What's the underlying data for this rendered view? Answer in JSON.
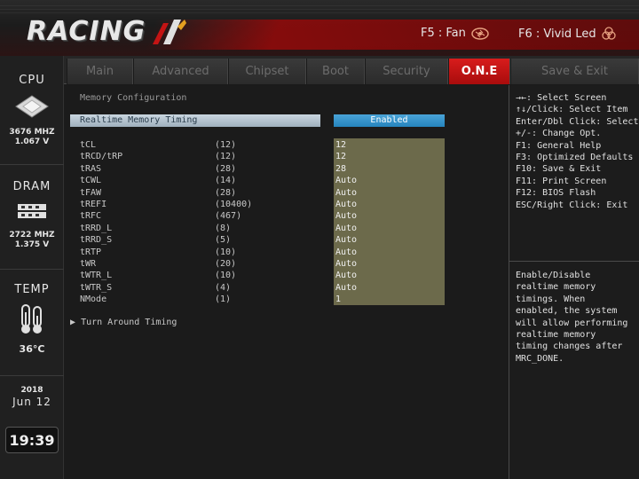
{
  "header": {
    "logo_text": "RACING",
    "fan_label": "F5 : Fan",
    "led_label": "F6 : Vivid Led"
  },
  "sidebar": {
    "cpu_title": "CPU",
    "cpu_freq": "3676 MHZ",
    "cpu_volt": "1.067 V",
    "dram_title": "DRAM",
    "dram_freq": "2722 MHZ",
    "dram_volt": "1.375 V",
    "temp_title": "TEMP",
    "temp_value": "36°C",
    "year": "2018",
    "date": "Jun 12",
    "time": "19:39"
  },
  "tabs": [
    "Main",
    "Advanced",
    "Chipset",
    "Boot",
    "Security",
    "O.N.E",
    "Save & Exit"
  ],
  "active_tab": "O.N.E",
  "main": {
    "section_title": "Memory Configuration",
    "realtime_label": "Realtime Memory Timing",
    "realtime_value": "Enabled",
    "timings": [
      {
        "label": "tCL",
        "current": "(12)",
        "value": "12"
      },
      {
        "label": "tRCD/tRP",
        "current": "(12)",
        "value": "12"
      },
      {
        "label": "tRAS",
        "current": "(28)",
        "value": "28"
      },
      {
        "label": "tCWL",
        "current": "(14)",
        "value": "Auto"
      },
      {
        "label": "tFAW",
        "current": "(28)",
        "value": "Auto"
      },
      {
        "label": "tREFI",
        "current": "(10400)",
        "value": "Auto"
      },
      {
        "label": "tRFC",
        "current": "(467)",
        "value": "Auto"
      },
      {
        "label": "tRRD_L",
        "current": "(8)",
        "value": "Auto"
      },
      {
        "label": "tRRD_S",
        "current": "(5)",
        "value": "Auto"
      },
      {
        "label": "tRTP",
        "current": "(10)",
        "value": "Auto"
      },
      {
        "label": "tWR",
        "current": "(20)",
        "value": "Auto"
      },
      {
        "label": "tWTR_L",
        "current": "(10)",
        "value": "Auto"
      },
      {
        "label": "tWTR_S",
        "current": "(4)",
        "value": "Auto"
      },
      {
        "label": "NMode",
        "current": "(1)",
        "value": "1"
      }
    ],
    "turn_around_label": "Turn Around Timing"
  },
  "help": {
    "keys": "→←: Select Screen\n↑↓/Click: Select Item\nEnter/Dbl Click: Select\n+/-: Change Opt.\nF1: General Help\nF3: Optimized Defaults\nF10: Save & Exit\nF11: Print Screen\nF12: BIOS Flash\nESC/Right Click: Exit",
    "description": "Enable/Disable\nrealtime memory\ntimings. When\nenabled, the system\nwill allow performing\nrealtime memory\ntiming changes after\nMRC_DONE."
  },
  "colors": {
    "accent_red": "#c41414",
    "value_bg": "#6c6a4b",
    "enabled_blue": "#2a8ac4"
  }
}
